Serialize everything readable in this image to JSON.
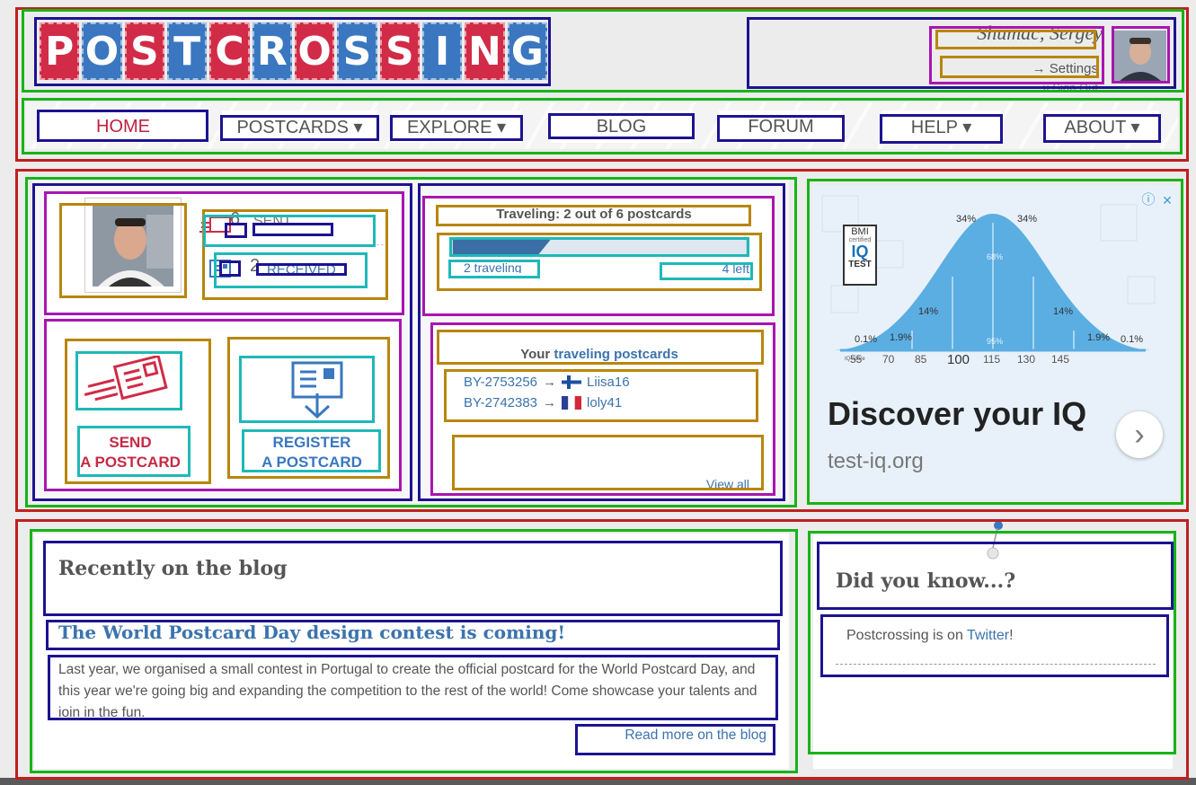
{
  "header": {
    "logo_letters": [
      "P",
      "O",
      "S",
      "T",
      "C",
      "R",
      "O",
      "S",
      "S",
      "I",
      "N",
      "G"
    ],
    "user_name": "Shumac, Sergey",
    "settings_link": "→ Settings",
    "signout_link": "× Sign Out"
  },
  "nav": {
    "items": [
      {
        "label": "HOME"
      },
      {
        "label": "POSTCARDS ▾"
      },
      {
        "label": "EXPLORE ▾"
      },
      {
        "label": "BLOG"
      },
      {
        "label": "FORUM"
      },
      {
        "label": "HELP ▾"
      },
      {
        "label": "ABOUT ▾"
      }
    ]
  },
  "stats": {
    "sent_count": "6",
    "sent_label": "SENT",
    "received_count": "2",
    "received_label": "RECEIVED"
  },
  "actions": {
    "send_label_1": "SEND",
    "send_label_2": "A POSTCARD",
    "register_label_1": "REGISTER",
    "register_label_2": "A POSTCARD"
  },
  "traveling": {
    "title": "Traveling: 2 out of 6 postcards",
    "progress_fraction": 0.333,
    "traveling_text": "2 traveling",
    "left_text": "4 left",
    "your_label": "Your",
    "your_link": "traveling postcards",
    "postcards": [
      {
        "id": "BY-2753256",
        "arrow": "→",
        "user": "Liisa16",
        "flag": "finland"
      },
      {
        "id": "BY-2742383",
        "arrow": "→",
        "user": "loly41",
        "flag": "france"
      }
    ],
    "view_all": "View all"
  },
  "ad": {
    "badge_top": "BMI",
    "badge_mid": "certified",
    "badge_iq": "IQ",
    "badge_test": "TEST",
    "pct_34a": "34%",
    "pct_34b": "34%",
    "pct_14a": "14%",
    "pct_14b": "14%",
    "pct_68": "68%",
    "pct_95": "95%",
    "pct_19a": "1.9%",
    "pct_19b": "1.9%",
    "pct_01a": "0.1%",
    "pct_01b": "0.1%",
    "iq_score_label": "IQ score",
    "scores": [
      "55",
      "70",
      "85",
      "100",
      "115",
      "130",
      "145"
    ],
    "headline": "Discover your IQ",
    "domain": "test-iq.org",
    "info": "ⓘ",
    "close": "✕",
    "next": "›"
  },
  "blog": {
    "section_title": "Recently on the blog",
    "post_title": "The World Postcard Day design contest is coming!",
    "post_excerpt": "Last year, we organised a small contest in Portugal to create the official postcard for the World Postcard Day, and this year we're going big and expanding the competition to the rest of the world! Come showcase your talents and join in the fun.",
    "read_more": "Read more on the blog"
  },
  "did_you_know": {
    "title": "Did you know...?",
    "text_before": "Postcrossing is on",
    "link": "Twitter",
    "text_after": "!"
  },
  "colors": {
    "brand_red": "#d12b47",
    "brand_blue": "#3a77c0",
    "link_blue": "#3b73ad"
  }
}
